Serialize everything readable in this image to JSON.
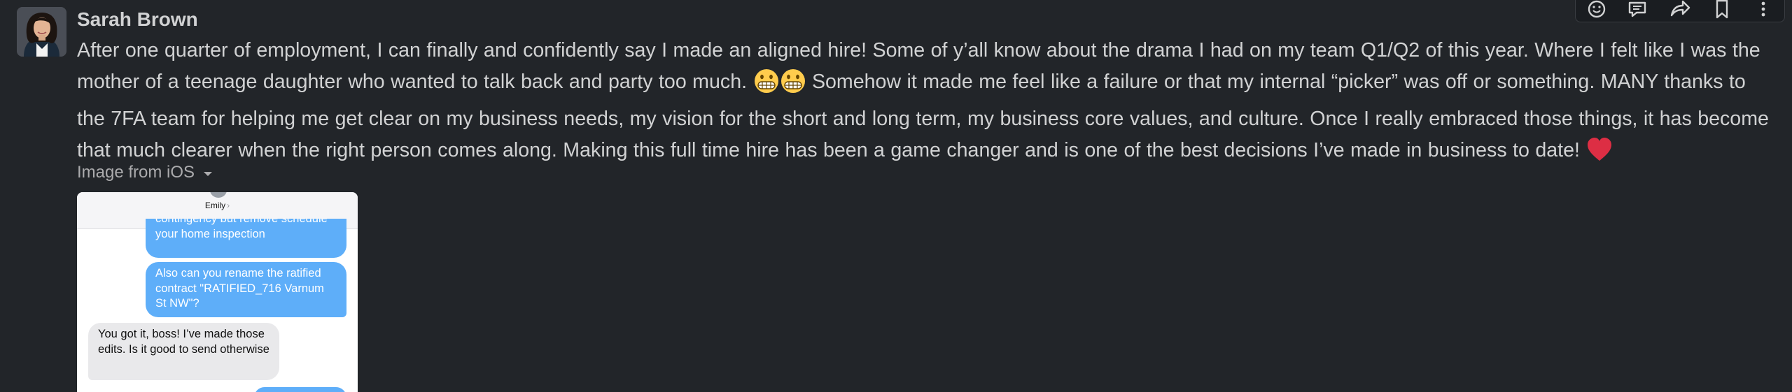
{
  "message": {
    "author": "Sarah Brown",
    "segments": {
      "s1": "After one quarter of employment, I can finally and confidently say I made an aligned hire! Some of y’all know about the drama I had on my team Q1/Q2 of this year. Where I felt like I was the mother of a teenage daughter who wanted to talk back and party too much. ",
      "s2": " Somehow it made me feel like a failure or that my internal “picker” was off or something. MANY thanks to the 7FA team for helping me get clear on my business needs, my vision for the short and long term, my business core values, and culture. Once I really embraced those things, it has become that much clearer when the right person comes along. Making this full time hire has been a game changer and is one of the best decisions I’ve made in business to date! "
    },
    "emojis": [
      "grimacing-face",
      "grimacing-face",
      "red-heart"
    ]
  },
  "toolbar": {
    "icons": [
      "emoji-reaction-icon",
      "reply-in-thread-icon",
      "share-icon",
      "bookmark-icon",
      "more-actions-icon"
    ]
  },
  "attachment": {
    "label": "Image from iOS",
    "thumbnail": {
      "contact": "Emily",
      "contact_chevron": "›",
      "bubbles": {
        "b1": "contingency but remove schedule your home inspection",
        "b2": "Also can you rename the ratified contract \"RATIFIED_716 Varnum St NW\"?",
        "b3": "You got it, boss! I’ve made those edits. Is it good to send otherwise",
        "b4": ""
      }
    }
  },
  "colors": {
    "background": "#222529",
    "text": "#d1d2d3",
    "muted": "#ababad",
    "outgoing_bubble": "#5eaef9",
    "incoming_bubble": "#e9e9eb",
    "heart": "#dd2e44",
    "emoji_face": "#ffcc4d"
  }
}
